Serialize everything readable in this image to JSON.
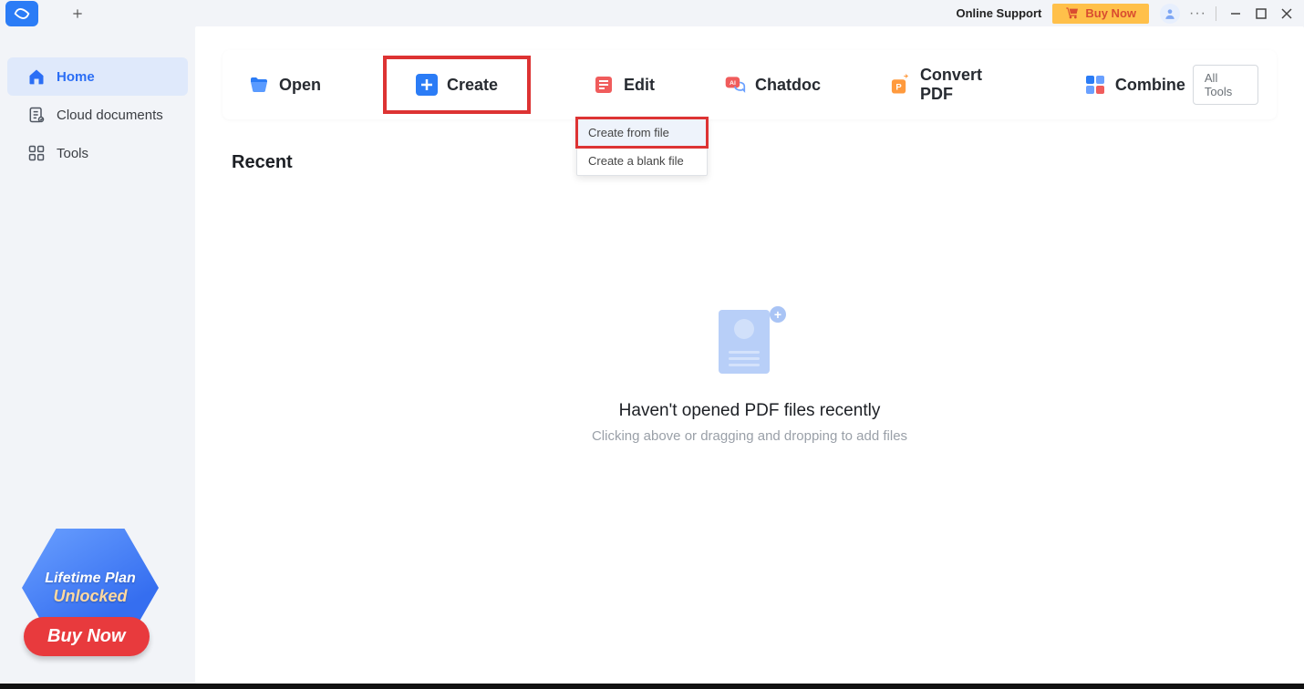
{
  "titlebar": {
    "online_support": "Online Support",
    "buy_now": "Buy Now"
  },
  "sidebar": {
    "items": [
      {
        "label": "Home"
      },
      {
        "label": "Cloud documents"
      },
      {
        "label": "Tools"
      }
    ]
  },
  "promo": {
    "line1": "Lifetime Plan",
    "line2": "Unlocked",
    "cta": "Buy Now"
  },
  "toolbar": {
    "open": "Open",
    "create": "Create",
    "edit": "Edit",
    "chatdoc": "Chatdoc",
    "convert": "Convert PDF",
    "combine": "Combine",
    "all_tools": "All Tools"
  },
  "dropdown": {
    "from_file": "Create from file",
    "blank": "Create a blank file"
  },
  "recent": {
    "heading": "Recent",
    "empty_title": "Haven't opened PDF files recently",
    "empty_sub": "Clicking above or dragging and dropping to add files"
  },
  "colors": {
    "accent": "#2b6ef5",
    "highlight_border": "#d33",
    "buy_now_bg": "#ffc04a"
  }
}
